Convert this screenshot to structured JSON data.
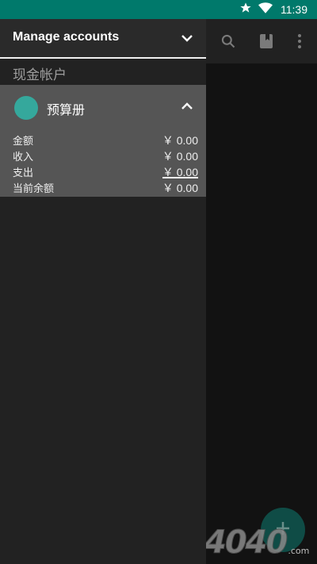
{
  "status_bar": {
    "time": "11:39",
    "icons": [
      "star-icon",
      "wifi-icon"
    ],
    "color": "#00796B"
  },
  "drawer": {
    "title": "Manage accounts",
    "cash_account": "现金帐户",
    "budget": {
      "name": "预算册",
      "avatar_color": "#35A89C",
      "rows": [
        {
          "label": "金额",
          "value": "￥ 0.00"
        },
        {
          "label": "收入",
          "value": "￥ 0.00"
        },
        {
          "label": "支出",
          "value": "￥ 0.00"
        },
        {
          "label": "当前余额",
          "value": "￥ 0.00"
        }
      ]
    }
  },
  "toolbar": {
    "icons": [
      "search-icon",
      "book-icon",
      "more-vert-icon"
    ]
  },
  "fab": {
    "icon": "add-icon"
  },
  "watermark": {
    "text": "4040",
    "suffix": ".com"
  }
}
